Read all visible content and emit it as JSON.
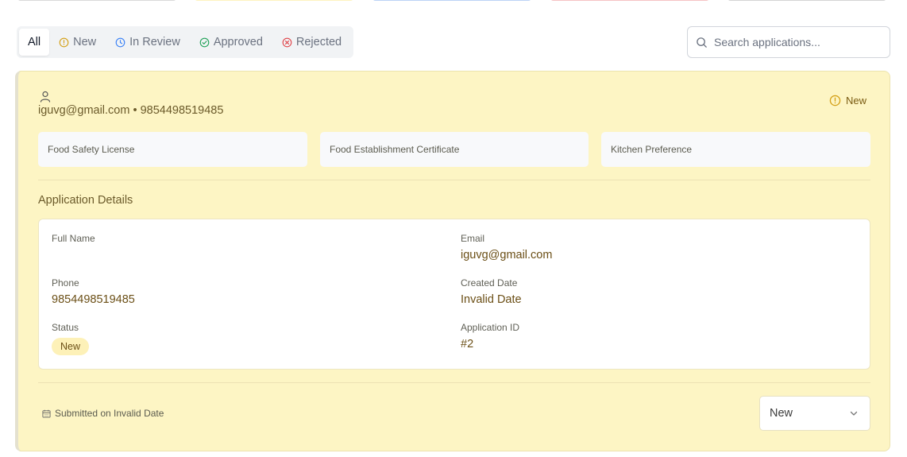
{
  "tabs": [
    {
      "label": "All",
      "icon": "",
      "active": true
    },
    {
      "label": "New",
      "icon": "alert-circle-icon",
      "color": "#d4a017"
    },
    {
      "label": "In Review",
      "icon": "clock-icon",
      "color": "#3b82f6"
    },
    {
      "label": "Approved",
      "icon": "check-circle-icon",
      "color": "#22a35a"
    },
    {
      "label": "Rejected",
      "icon": "x-circle-icon",
      "color": "#e0474c"
    }
  ],
  "search": {
    "placeholder": "Search applications..."
  },
  "application": {
    "contact": "iguvg@gmail.com • 9854498519485",
    "status": "New",
    "documents": [
      "Food Safety License",
      "Food Establishment Certificate",
      "Kitchen Preference"
    ],
    "details_title": "Application Details",
    "fields": {
      "full_name_label": "Full Name",
      "full_name_value": "",
      "email_label": "Email",
      "email_value": "iguvg@gmail.com",
      "phone_label": "Phone",
      "phone_value": "9854498519485",
      "created_label": "Created Date",
      "created_value": "Invalid Date",
      "status_label": "Status",
      "status_value": "New",
      "id_label": "Application ID",
      "id_value": "#2"
    },
    "submitted": "Submitted on Invalid Date",
    "status_select": "New"
  },
  "colors": {
    "card_bg": "#fdf5c4",
    "accent_text": "#6b4f16",
    "new_icon": "#d4a017"
  }
}
